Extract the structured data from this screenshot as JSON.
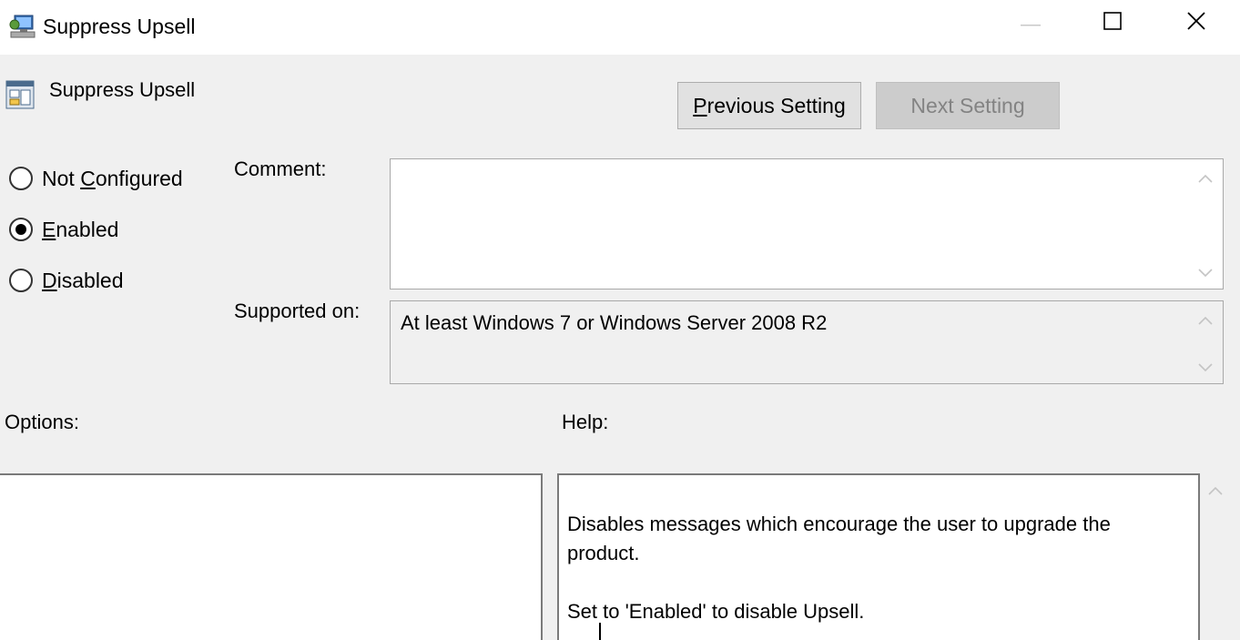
{
  "window": {
    "title": "Suppress Upsell",
    "controls": [
      "minimize-icon",
      "maximize-icon",
      "close-icon"
    ]
  },
  "header": {
    "setting_name": "Suppress Upsell",
    "prev_button": {
      "prefix": "P",
      "rest": "revious Setting"
    },
    "next_button": "Next Setting"
  },
  "state": {
    "options": [
      {
        "pre": "Not ",
        "u": "C",
        "post": "onfigured",
        "selected": false
      },
      {
        "pre": "",
        "u": "E",
        "post": "nabled",
        "selected": true
      },
      {
        "pre": "",
        "u": "D",
        "post": "isabled",
        "selected": false
      }
    ]
  },
  "comment": {
    "label": "Comment:",
    "value": ""
  },
  "supported": {
    "label": "Supported on:",
    "value": "At least Windows 7 or Windows Server 2008 R2"
  },
  "options_panel": {
    "label": "Options:"
  },
  "help_panel": {
    "label": "Help:",
    "paragraph1": "Disables messages which encourage the user to upgrade the product.",
    "paragraph2": "Set to 'Enabled' to disable Upsell."
  },
  "colors": {
    "disabled_text": "#838383",
    "button_bg": "#e1e1e1",
    "window_bg": "#f0f0f0"
  }
}
